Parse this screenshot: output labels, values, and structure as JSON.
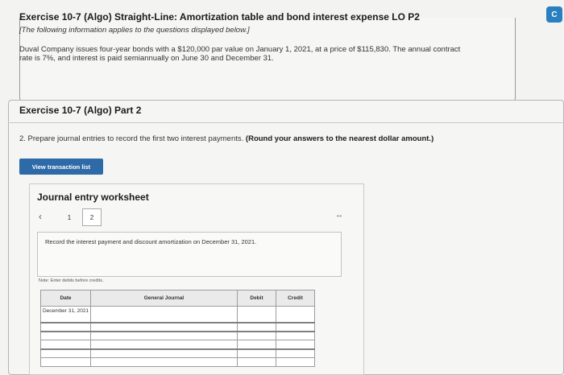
{
  "colors": {
    "accent": "#2f6aa8",
    "badge": "#2a7fc1"
  },
  "corner_badge": "C",
  "intro": {
    "title": "Exercise 10-7 (Algo) Straight-Line: Amortization table and bond interest expense LO P2",
    "note": "[The following information applies to the questions displayed below.]",
    "text": "Duval Company issues four-year bonds with a $120,000 par value on January 1, 2021, at a price of $115,830. The annual contract rate is 7%, and interest is paid semiannually on June 30 and December 31."
  },
  "part": {
    "title": "Exercise 10-7 (Algo) Part 2",
    "instruction": "2. Prepare journal entries to record the first two interest payments.",
    "instruction_bold": "(Round your answers to the nearest dollar amount.)",
    "view_button": "View transaction list"
  },
  "worksheet": {
    "title": "Journal entry worksheet",
    "prev_icon": "chevron-left-icon",
    "expand_icon": "expand-arrows-icon",
    "tabs": [
      "1",
      "2"
    ],
    "active_tab": "2",
    "record_text": "Record the interest payment and discount amortization on December 31, 2021.",
    "note": "Note: Enter debits before credits.",
    "columns": {
      "date": "Date",
      "account": "General Journal",
      "debit": "Debit",
      "credit": "Credit"
    },
    "rows": [
      {
        "date": "December 31, 2021",
        "account": "",
        "debit": "",
        "credit": ""
      },
      {
        "date": "",
        "account": "",
        "debit": "",
        "credit": ""
      },
      {
        "date": "",
        "account": "",
        "debit": "",
        "credit": ""
      },
      {
        "date": "",
        "account": "",
        "debit": "",
        "credit": ""
      },
      {
        "date": "",
        "account": "",
        "debit": "",
        "credit": ""
      },
      {
        "date": "",
        "account": "",
        "debit": "",
        "credit": ""
      }
    ]
  }
}
